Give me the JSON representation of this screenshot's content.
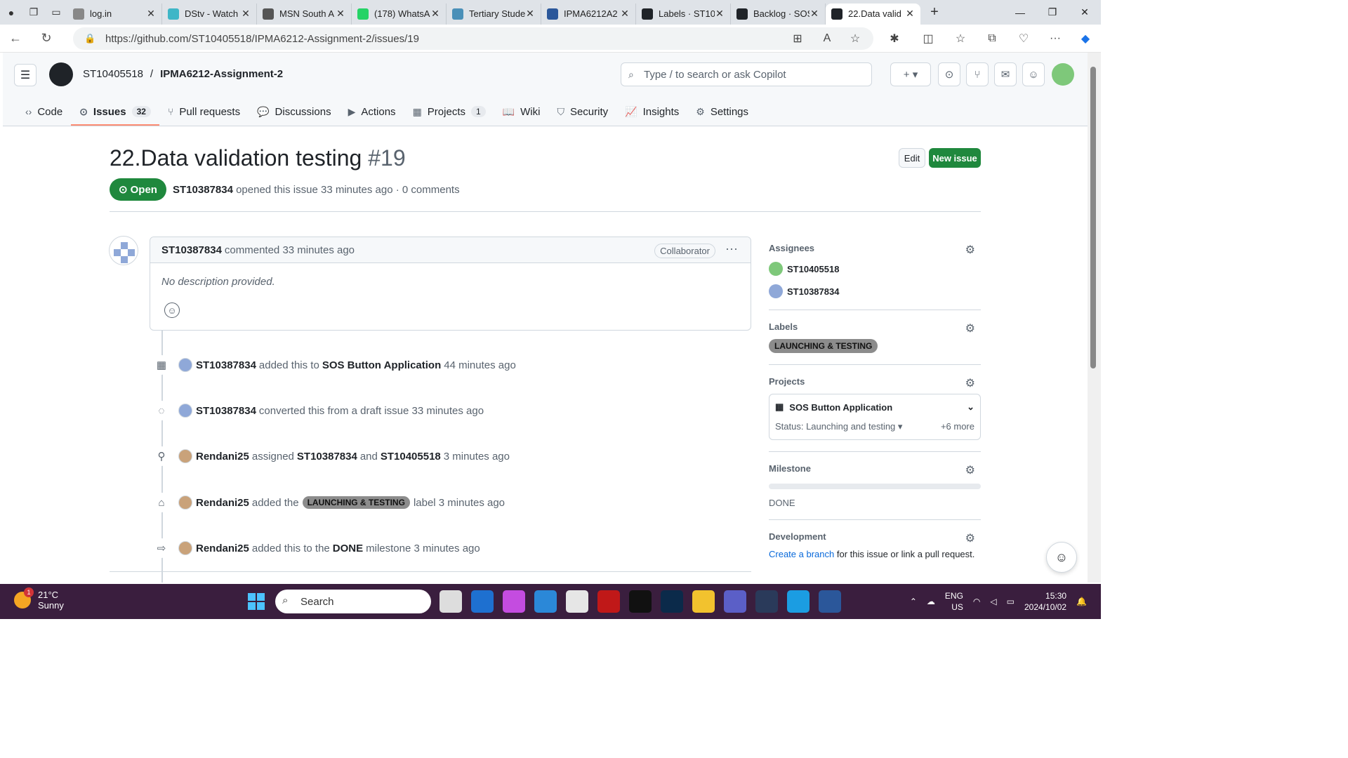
{
  "browser": {
    "tabs": [
      {
        "label": "log.in",
        "color": "#888"
      },
      {
        "label": "DStv - Watch",
        "color": "#3fb6c7"
      },
      {
        "label": "MSN South A",
        "color": "#555"
      },
      {
        "label": "(178) WhatsA",
        "color": "#25d366"
      },
      {
        "label": "Tertiary Stude",
        "color": "#4a90b8"
      },
      {
        "label": "IPMA6212A2",
        "color": "#2b579a"
      },
      {
        "label": "Labels · ST10",
        "color": "#1f2328"
      },
      {
        "label": "Backlog · SOS",
        "color": "#1f2328"
      },
      {
        "label": "22.Data valid",
        "color": "#1f2328"
      }
    ],
    "url": "https://github.com/ST10405518/IPMA6212-Assignment-2/issues/19"
  },
  "header": {
    "owner": "ST10405518",
    "sep": "/",
    "repo": "IPMA6212-Assignment-2",
    "search_placeholder": "Type / to search or ask Copilot"
  },
  "nav": [
    {
      "label": "Code",
      "icon": "‹›"
    },
    {
      "label": "Issues",
      "icon": "⊙",
      "count": "32"
    },
    {
      "label": "Pull requests",
      "icon": "⑂"
    },
    {
      "label": "Discussions",
      "icon": "💬"
    },
    {
      "label": "Actions",
      "icon": "▶"
    },
    {
      "label": "Projects",
      "icon": "▦",
      "count": "1"
    },
    {
      "label": "Wiki",
      "icon": "📖"
    },
    {
      "label": "Security",
      "icon": "⛉"
    },
    {
      "label": "Insights",
      "icon": "📈"
    },
    {
      "label": "Settings",
      "icon": "⚙"
    }
  ],
  "issue": {
    "title": "22.Data validation testing",
    "number": "#19",
    "edit": "Edit",
    "new": "New issue",
    "state": "Open",
    "author": "ST10387834",
    "meta_rest": "opened this issue 33 minutes ago · 0 comments"
  },
  "comment": {
    "author": "ST10387834",
    "when": "commented 33 minutes ago",
    "role": "Collaborator",
    "body": "No description provided."
  },
  "events": [
    {
      "actor": "ST10387834",
      "t1": "added this to",
      "t2": "SOS Button Application",
      "t3": "44 minutes ago",
      "t4": "",
      "t5": ""
    },
    {
      "actor": "ST10387834",
      "t1": "converted this from a draft issue 33 minutes ago",
      "t2": "",
      "t3": "",
      "t4": "",
      "t5": ""
    },
    {
      "actor": "Rendani25",
      "t1": "assigned",
      "t2": "ST10387834",
      "t3": "and",
      "t4": "ST10405518",
      "t5": "3 minutes ago"
    },
    {
      "actor": "Rendani25",
      "t1": "added the",
      "label": "LAUNCHING & TESTING",
      "t3": "label 3 minutes ago"
    },
    {
      "actor": "Rendani25",
      "t1": "added this to the",
      "t2": "DONE",
      "t3": "milestone 3 minutes ago"
    }
  ],
  "sidebar": {
    "assignees_h": "Assignees",
    "assignees": [
      "ST10405518",
      "ST10387834"
    ],
    "labels_h": "Labels",
    "label": "LAUNCHING & TESTING",
    "projects_h": "Projects",
    "project": "SOS Button Application",
    "status": "Status: Launching and testing",
    "more": "+6 more",
    "milestone_h": "Milestone",
    "milestone": "DONE",
    "development_h": "Development",
    "dev_link": "Create a branch",
    "dev_rest": " for this issue or link a pull request."
  },
  "taskbar": {
    "temp": "21°C",
    "weather": "Sunny",
    "badge": "1",
    "search": "Search",
    "lang1": "ENG",
    "lang2": "US",
    "time": "15:30",
    "date": "2024/10/02"
  }
}
